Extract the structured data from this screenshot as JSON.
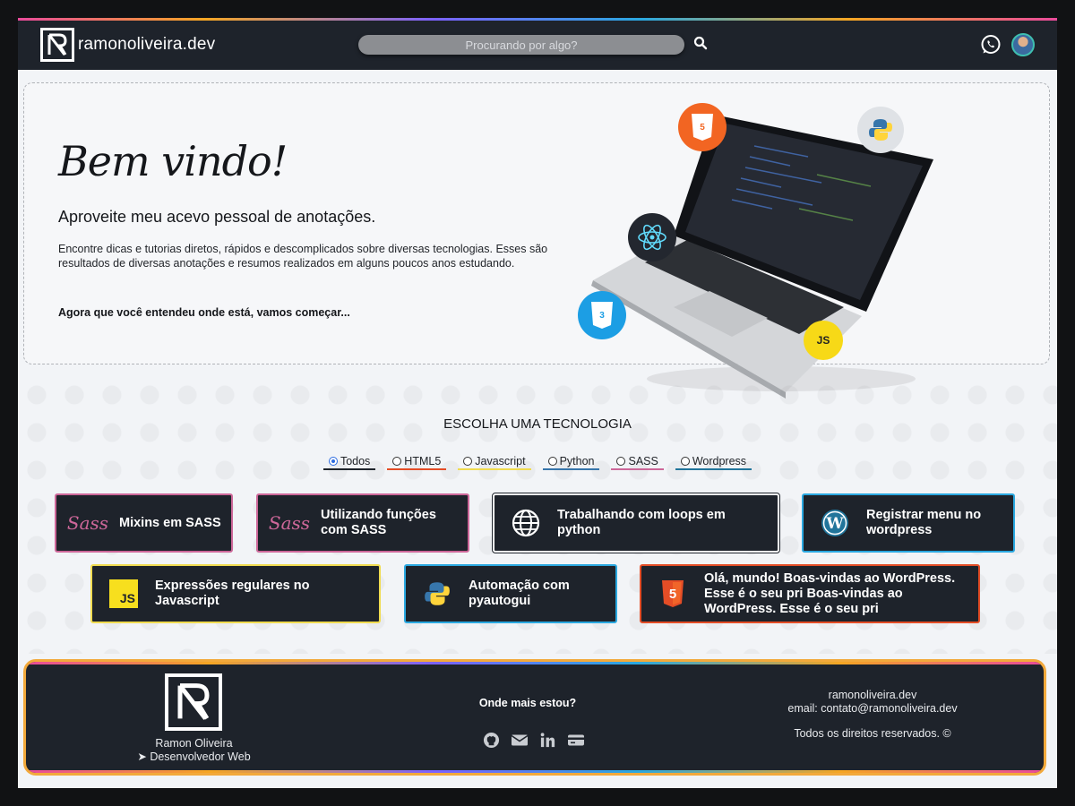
{
  "header": {
    "logo_text": "ramonoliveira.dev",
    "search_placeholder": "Procurando por algo?",
    "icons": [
      "logo-icon",
      "search-icon",
      "whatsapp-icon",
      "avatar"
    ]
  },
  "hero": {
    "title": "Bem vindo!",
    "subtitle": "Aproveite meu acevo pessoal de anotações.",
    "text": "Encontre dicas e tutorias diretos, rápidos e descomplicados sobre diversas tecnologias. Esses são resultados de diversas anotações e resumos realizados em alguns poucos anos estudando.",
    "cta": "Agora que você entendeu onde está, vamos começar...",
    "badges": {
      "html": "HTML",
      "css": "CSS",
      "js": "JS"
    }
  },
  "tech": {
    "title": "ESCOLHA UMA TECNOLOGIA",
    "filters": [
      {
        "label": "Todos",
        "selected": true,
        "color": "#1e232b"
      },
      {
        "label": "HTML5",
        "selected": false,
        "color": "#e44d26"
      },
      {
        "label": "Javascript",
        "selected": false,
        "color": "#f0db4f"
      },
      {
        "label": "Python",
        "selected": false,
        "color": "#3776ab"
      },
      {
        "label": "SASS",
        "selected": false,
        "color": "#cd6799"
      },
      {
        "label": "Wordpress",
        "selected": false,
        "color": "#21759b"
      }
    ]
  },
  "cards": [
    {
      "label": "Mixins em SASS",
      "icon": "sass-icon",
      "border": "#cd6799"
    },
    {
      "label": "Utilizando funções com SASS",
      "icon": "sass-icon",
      "border": "#cd6799"
    },
    {
      "label": "Trabalhando com loops em python",
      "icon": "globe-icon",
      "border": "#ffffff"
    },
    {
      "label": "Registrar menu no wordpress",
      "icon": "wordpress-icon",
      "border": "#2aa8e0"
    },
    {
      "label": "Expressões regulares no Javascript",
      "icon": "javascript-icon",
      "border": "#f0db4f"
    },
    {
      "label": "Automação com pyautogui",
      "icon": "python-icon",
      "border": "#2aa8e0"
    },
    {
      "label": "Olá, mundo! Boas-vindas ao WordPress. Esse é o seu pri Boas-vindas ao WordPress. Esse é o seu pri",
      "icon": "html5-icon",
      "border": "#e44d26"
    }
  ],
  "footer": {
    "name": "Ramon Oliveira",
    "role": "Desenvolvedor Web",
    "where_title": "Onde mais estou?",
    "site": "ramonoliveira.dev",
    "email": "email: contato@ramonoliveira.dev",
    "rights": "Todos os direitos reservados. ©",
    "social_icons": [
      "github-icon",
      "mail-icon",
      "linkedin-icon",
      "card-icon"
    ]
  }
}
